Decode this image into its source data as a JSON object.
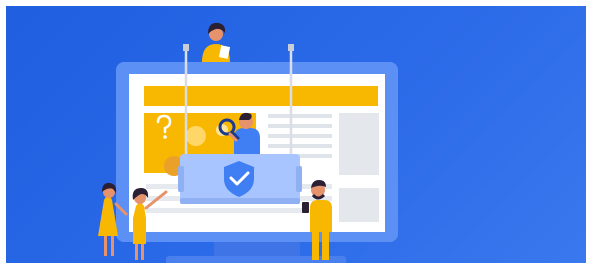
{
  "illustration": {
    "icons": [
      "shield-check-icon",
      "magnifier-icon",
      "question-mark-icon",
      "smartphone-icon",
      "document-icon"
    ],
    "colors": {
      "background": "#2563e6",
      "monitor_frame": "#5d90f4",
      "screen": "#ffffff",
      "accent_yellow": "#f8b700",
      "content_gray": "#dfe3ea",
      "shield": "#3f7ff3",
      "skin": "#e6926b",
      "hair": "#2a1f33"
    }
  }
}
